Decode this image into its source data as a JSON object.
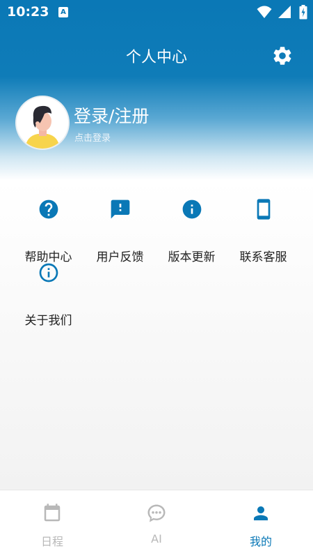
{
  "status_bar": {
    "time": "10:23",
    "notification_letter": "A"
  },
  "header": {
    "title": "个人中心",
    "settings_icon": "gear-icon",
    "accent": "#0a78b6"
  },
  "profile": {
    "login_label": "登录/注册",
    "login_hint": "点击登录"
  },
  "menu": [
    {
      "label": "帮助中心",
      "icon": "question-circle-icon"
    },
    {
      "label": "用户反馈",
      "icon": "feedback-icon"
    },
    {
      "label": "版本更新",
      "icon": "info-circle-icon"
    },
    {
      "label": "联系客服",
      "icon": "phone-icon"
    },
    {
      "label": "关于我们",
      "icon": "info-outline-icon"
    }
  ],
  "bottom_nav": {
    "items": [
      {
        "label": "日程",
        "icon": "calendar-icon",
        "active": false
      },
      {
        "label": "AI",
        "icon": "chat-bubble-icon",
        "active": false
      },
      {
        "label": "我的",
        "icon": "person-icon",
        "active": true
      }
    ],
    "active_color": "#0a78b6",
    "inactive_color": "#b8b8b8"
  }
}
